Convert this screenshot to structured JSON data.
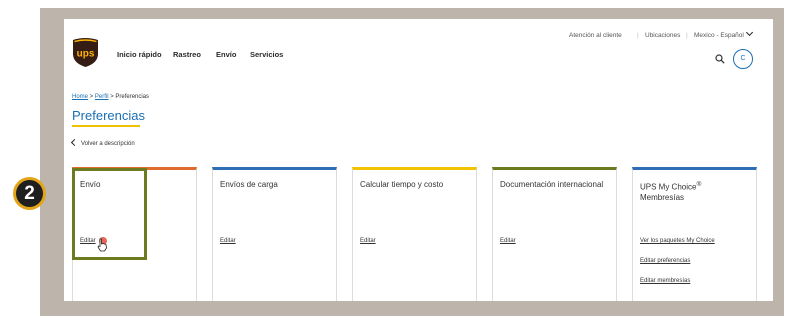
{
  "nav": {
    "items": [
      "Inicio rápido",
      "Rastreo",
      "Envío",
      "Servicios"
    ]
  },
  "utility": {
    "support": "Atención al cliente",
    "locations": "Ubicaciones",
    "locale": "Mexico - Español",
    "separator": "|"
  },
  "user": {
    "initial": "C"
  },
  "breadcrumb": {
    "home": "Home",
    "profile": "Perfil",
    "current": "Preferencias",
    "sep": " > "
  },
  "page": {
    "title": "Preferencias",
    "back": "Volver a descripción"
  },
  "cards": [
    {
      "title": "Envío",
      "links": [
        "Editar"
      ],
      "accent": "#e06b2e"
    },
    {
      "title": "Envíos de carga",
      "links": [
        "Editar"
      ],
      "accent": "#2f6db5"
    },
    {
      "title": "Calcular tiempo y costo",
      "links": [
        "Editar"
      ],
      "accent": "#f1c200"
    },
    {
      "title": "Documentación internacional",
      "links": [
        "Editar"
      ],
      "accent": "#6b7b1f"
    },
    {
      "title": "UPS My Choice",
      "title_sup": "®",
      "title_2": "Membresías",
      "links": [
        "Ver los paquetes My Choice",
        "Editar preferencias",
        "Editar membresías"
      ],
      "accent": "#2f6db5"
    }
  ],
  "annotation": {
    "step": "2"
  },
  "colors": {
    "brand_brown": "#351c15",
    "brand_gold": "#ffb500",
    "link_blue": "#1a6fb3",
    "highlight_green": "#6b7b1f"
  },
  "icons": [
    "ups-logo-icon",
    "search-icon",
    "chevron-down-icon",
    "back-arrow-icon",
    "pointer-cursor-icon"
  ]
}
